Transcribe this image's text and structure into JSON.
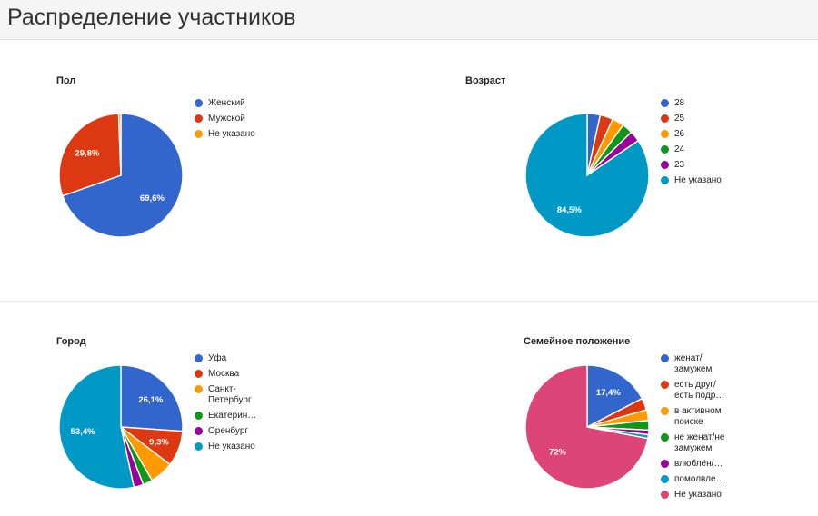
{
  "header": {
    "title": "Распределение участников"
  },
  "charts": [
    {
      "id": "gender",
      "title": "Пол",
      "chart_data": {
        "type": "pie",
        "title": "Пол",
        "categories": [
          "Женский",
          "Мужской",
          "Не указано"
        ],
        "values": [
          69.6,
          29.8,
          0.6
        ],
        "value_labels": [
          "69,6%",
          "29,8%",
          ""
        ],
        "shown_labels": [
          "69,6%",
          "29,8%"
        ],
        "colors": [
          "#3366cc",
          "#dc3912",
          "#ff9900"
        ],
        "legend_position": "right",
        "units": "%"
      }
    },
    {
      "id": "age",
      "title": "Возраст",
      "chart_data": {
        "type": "pie",
        "title": "Возраст",
        "categories": [
          "28",
          "25",
          "26",
          "24",
          "23",
          "Не указано"
        ],
        "values": [
          3.4,
          3.4,
          3.1,
          2.8,
          2.8,
          84.5
        ],
        "value_labels": [
          "",
          "",
          "",
          "",
          "",
          "84,5%"
        ],
        "shown_labels": [
          "84,5%"
        ],
        "colors": [
          "#3366cc",
          "#dc3912",
          "#ff9900",
          "#109618",
          "#990099",
          "#0099c6"
        ],
        "legend_position": "right",
        "units": "%"
      }
    },
    {
      "id": "city",
      "title": "Город",
      "chart_data": {
        "type": "pie",
        "title": "Город",
        "categories": [
          "Уфа",
          "Москва",
          "Санкт-\nПетербург",
          "Екатерин…",
          "Оренбург",
          "Не указано"
        ],
        "values": [
          26.1,
          9.3,
          6.2,
          2.5,
          2.5,
          53.4
        ],
        "value_labels": [
          "26,1%",
          "9,3%",
          "",
          "",
          "",
          "53,4%"
        ],
        "shown_labels": [
          "26,1%",
          "9,3%",
          "53,4%"
        ],
        "colors": [
          "#3366cc",
          "#dc3912",
          "#ff9900",
          "#109618",
          "#990099",
          "#0099c6"
        ],
        "legend_position": "right",
        "units": "%"
      }
    },
    {
      "id": "marital",
      "title": "Семейное положение",
      "chart_data": {
        "type": "pie",
        "title": "Семейное положение",
        "categories": [
          "женат/\nзамужем",
          "есть друг/\nесть подр…",
          "в активном\nпоиске",
          "не женат/не\nзамужем",
          "влюблён/…",
          "помолвле…",
          "Не указано"
        ],
        "values": [
          17.4,
          3.1,
          2.8,
          2.5,
          1.2,
          1.0,
          72.0
        ],
        "value_labels": [
          "17,4%",
          "",
          "",
          "",
          "",
          "",
          "72%"
        ],
        "shown_labels": [
          "17,4%",
          "72%"
        ],
        "colors": [
          "#3366cc",
          "#dc3912",
          "#ff9900",
          "#109618",
          "#990099",
          "#0099c6",
          "#dd4477"
        ],
        "legend_position": "right",
        "units": "%"
      }
    }
  ]
}
